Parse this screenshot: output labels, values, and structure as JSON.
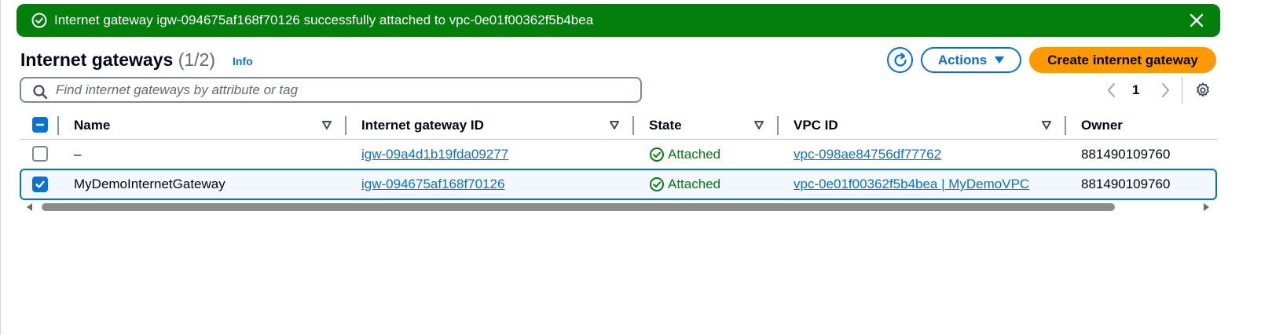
{
  "flash": {
    "message": "Internet gateway igw-094675af168f70126 successfully attached to vpc-0e01f00362f5b4bea",
    "color": "#037f0c"
  },
  "header": {
    "title": "Internet gateways",
    "count": "(1/2)",
    "info_label": "Info"
  },
  "toolbar": {
    "actions_label": "Actions",
    "create_label": "Create internet gateway"
  },
  "search": {
    "placeholder": "Find internet gateways by attribute or tag"
  },
  "pagination": {
    "current_page": "1"
  },
  "table": {
    "columns": [
      "Name",
      "Internet gateway ID",
      "State",
      "VPC ID",
      "Owner"
    ],
    "rows": [
      {
        "selected": false,
        "name": "–",
        "gateway_id": "igw-09a4d1b19fda09277",
        "state": "Attached",
        "vpc_id": "vpc-098ae84756df77762",
        "owner": "881490109760"
      },
      {
        "selected": true,
        "name": "MyDemoInternetGateway",
        "gateway_id": "igw-094675af168f70126",
        "state": "Attached",
        "vpc_id": "vpc-0e01f00362f5b4bea | MyDemoVPC",
        "owner": "881490109760"
      }
    ]
  },
  "colors": {
    "primary": "#0972d3",
    "create_button": "#ff9900",
    "success": "#037f0c"
  }
}
